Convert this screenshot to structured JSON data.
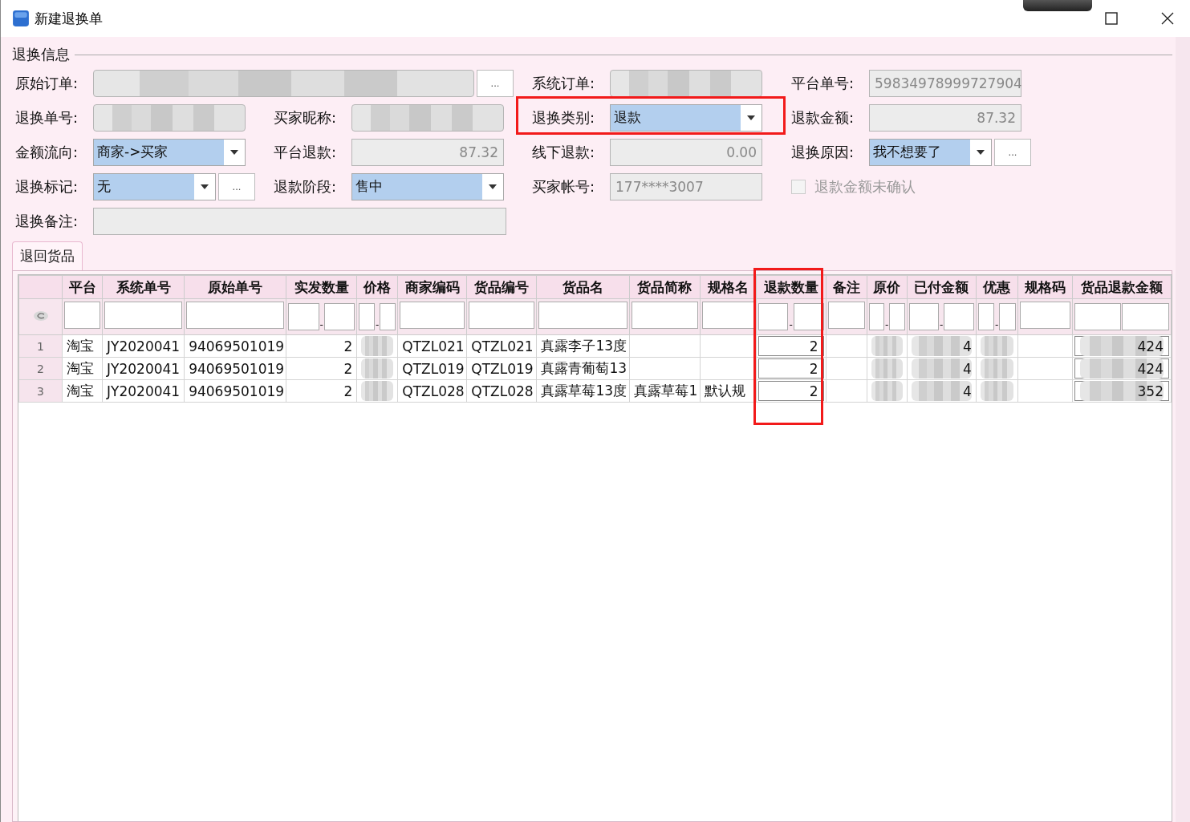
{
  "window": {
    "title": "新建退换单"
  },
  "section": {
    "title": "退换信息"
  },
  "form_rows": [
    [
      {
        "label": "原始订单:",
        "kind": "text",
        "blurred": true,
        "more_button": "..."
      },
      {
        "label": "系统订单:",
        "kind": "text",
        "blurred": true
      },
      {
        "label": "平台单号:",
        "kind": "text",
        "value": "59834978999727904"
      }
    ],
    [
      {
        "label": "退换单号:",
        "kind": "text",
        "blurred": true
      },
      {
        "label": "买家昵称:",
        "kind": "text",
        "blurred": true
      },
      {
        "label": "退换类别:",
        "kind": "combo",
        "value": "退款",
        "highlighted": true
      },
      {
        "label": "退款金额:",
        "kind": "number",
        "value": "87.32"
      }
    ],
    [
      {
        "label": "金额流向:",
        "kind": "combo",
        "value": "商家->买家"
      },
      {
        "label": "平台退款:",
        "kind": "number",
        "value": "87.32"
      },
      {
        "label": "线下退款:",
        "kind": "number",
        "value": "0.00"
      },
      {
        "label": "退换原因:",
        "kind": "combo",
        "value": "我不想要了",
        "more_button": "..."
      }
    ],
    [
      {
        "label": "退换标记:",
        "kind": "combo",
        "value": "无",
        "more_button": "..."
      },
      {
        "label": "退款阶段:",
        "kind": "combo",
        "value": "售中"
      },
      {
        "label": "买家帐号:",
        "kind": "text",
        "value": "177****3007"
      },
      {
        "label": "退款金额未确认",
        "kind": "checkbox",
        "checked": false,
        "disabled": true
      }
    ],
    [
      {
        "label": "退换备注:",
        "kind": "text"
      }
    ]
  ],
  "tabs": [
    {
      "label": "退回货品",
      "selected": true
    }
  ],
  "grid": {
    "columns": [
      {
        "label": "平台",
        "kind": "text"
      },
      {
        "label": "系统单号",
        "kind": "text"
      },
      {
        "label": "原始单号",
        "kind": "text"
      },
      {
        "label": "实发数量",
        "kind": "range",
        "separator": "-"
      },
      {
        "label": "价格",
        "kind": "range",
        "separator": "-"
      },
      {
        "label": "商家编码",
        "kind": "text"
      },
      {
        "label": "货品编号",
        "kind": "text"
      },
      {
        "label": "货品名",
        "kind": "text"
      },
      {
        "label": "货品简称",
        "kind": "text"
      },
      {
        "label": "规格名",
        "kind": "text"
      },
      {
        "label": "退款数量",
        "kind": "range",
        "separator": "-",
        "editable": true,
        "highlighted": true
      },
      {
        "label": "备注",
        "kind": "text"
      },
      {
        "label": "原价",
        "kind": "range",
        "separator": "-"
      },
      {
        "label": "已付金额",
        "kind": "range",
        "separator": "-"
      },
      {
        "label": "优惠",
        "kind": "range",
        "separator": "-"
      },
      {
        "label": "规格码",
        "kind": "text"
      },
      {
        "label": "货品退款金额",
        "kind": "range",
        "editable": true
      }
    ],
    "rows": [
      {
        "number": "1",
        "cells": [
          "淘宝",
          "JY2020041",
          "94069501019",
          "2",
          {
            "blurred": true
          },
          "QTZL021",
          "QTZL021",
          "真露李子13度",
          "",
          "",
          "2",
          "",
          {
            "blurred": true
          },
          {
            "blurred": true,
            "text": "4"
          },
          {
            "blurred": true
          },
          "",
          {
            "blurred": true,
            "text": "424"
          }
        ]
      },
      {
        "number": "2",
        "cells": [
          "淘宝",
          "JY2020041",
          "94069501019",
          "2",
          {
            "blurred": true
          },
          "QTZL019",
          "QTZL019",
          "真露青葡萄13",
          "",
          "",
          "2",
          "",
          {
            "blurred": true
          },
          {
            "blurred": true,
            "text": "4"
          },
          {
            "blurred": true
          },
          "",
          {
            "blurred": true,
            "text": "424"
          }
        ]
      },
      {
        "number": "3",
        "cells": [
          "淘宝",
          "JY2020041",
          "94069501019",
          "2",
          {
            "blurred": true
          },
          "QTZL028",
          "QTZL028",
          "真露草莓13度",
          "真露草莓1",
          "默认规",
          "2",
          "",
          {
            "blurred": true
          },
          {
            "blurred": true,
            "text": "4"
          },
          {
            "blurred": true
          },
          "",
          {
            "blurred": true,
            "text": "352"
          }
        ]
      }
    ]
  }
}
